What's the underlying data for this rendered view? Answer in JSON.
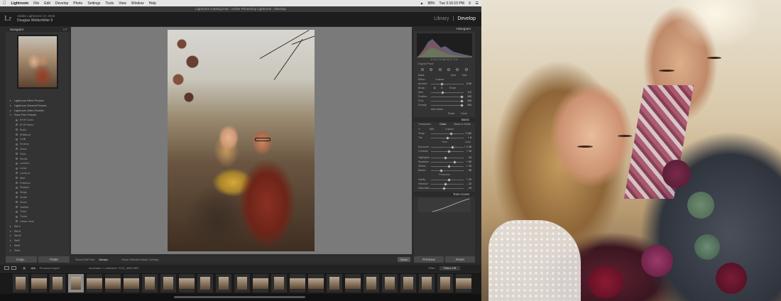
{
  "menubar": {
    "app_name": "Lightroom",
    "items": [
      "File",
      "Edit",
      "Develop",
      "Photo",
      "Settings",
      "Tools",
      "View",
      "Window",
      "Help"
    ],
    "status": [
      "88%",
      "Tue 3:16:10 PM"
    ]
  },
  "window": {
    "title": "Lightroom Catalog.lrcat - Adobe Photoshop Lightroom - Develop"
  },
  "identity": {
    "logo": "Lr",
    "product": "Adobe Lightroom CC 2015",
    "user": "Douglas Wettenhiller II"
  },
  "modules": {
    "library": "Library",
    "separator": "|",
    "develop": "Develop"
  },
  "navigator": {
    "title": "Navigator",
    "zoom": "FIT"
  },
  "presets": [
    {
      "label": "Lightroom Effect Presets",
      "sub": false
    },
    {
      "label": "Lightroom General Presets",
      "sub": false
    },
    {
      "label": "Lightroom Video Presets",
      "sub": false
    },
    {
      "label": "Rose Film Presets",
      "sub": false,
      "open": true
    },
    {
      "label": "B+W Cools",
      "sub": true
    },
    {
      "label": "B+W Warm",
      "sub": true
    },
    {
      "label": "Basic",
      "sub": true
    },
    {
      "label": "Brilliance",
      "sub": true
    },
    {
      "label": "Chilli",
      "sub": true
    },
    {
      "label": "Embers",
      "sub": true
    },
    {
      "label": "Gloss",
      "sub": true
    },
    {
      "label": "Glow",
      "sub": true
    },
    {
      "label": "Kindle",
      "sub": true
    },
    {
      "label": "Lumiere",
      "sub": true
    },
    {
      "label": "Lunar",
      "sub": true
    },
    {
      "label": "Luminox",
      "sub": true
    },
    {
      "label": "Mint",
      "sub": true
    },
    {
      "label": "Polished",
      "sub": true
    },
    {
      "label": "Radiant",
      "sub": true
    },
    {
      "label": "Singe",
      "sub": true
    },
    {
      "label": "Spark",
      "sub": true
    },
    {
      "label": "Storm",
      "sub": true
    },
    {
      "label": "Swelter",
      "sub": true
    },
    {
      "label": "Thaw",
      "sub": true
    },
    {
      "label": "Tinder",
      "sub": true
    },
    {
      "label": "Urban Haze",
      "sub": true
    },
    {
      "label": "Set 1",
      "sub": false
    },
    {
      "label": "Set II",
      "sub": false
    },
    {
      "label": "Set I1",
      "sub": false
    },
    {
      "label": "Set2",
      "sub": false
    },
    {
      "label": "Set3",
      "sub": false
    },
    {
      "label": "Set4",
      "sub": false
    }
  ],
  "left_buttons": {
    "copy": "Copy...",
    "paste": "Paste"
  },
  "toolbar": {
    "show_edit_pins": "Show Edit Pins :",
    "edit_pins_value": "Always",
    "show_mask_overlay": "Show Selected Mask Overlay",
    "done": "Done"
  },
  "histogram": {
    "title": "Histogram",
    "readout": "R 22.4  G 26.0  B 17.9 %",
    "original_photo": "Original Photo"
  },
  "brush": {
    "mask_label": "Mask :",
    "mask_new": "New",
    "mask_edit": "Edit",
    "effect_label": "Effect :",
    "effect_value": "Custom",
    "amount_label": "Amount",
    "amount_value": "0.00",
    "brush_label": "Brush :",
    "brush_a": "A",
    "brush_b": "B",
    "brush_erase": "Erase",
    "rows": [
      {
        "label": "Size",
        "value": "9.0",
        "pos": 0.35
      },
      {
        "label": "Feather",
        "value": "100",
        "pos": 0.95
      },
      {
        "label": "Flow",
        "value": "100",
        "pos": 0.95
      },
      {
        "label": "Density",
        "value": "100",
        "pos": 0.95
      }
    ],
    "automask": "Auto Mask",
    "reset": "Reset",
    "close": "Close"
  },
  "basic": {
    "title": "Basic",
    "treatment_label": "Treatment :",
    "color": "Color",
    "bw": "Black & White",
    "wb_label": "WB :",
    "wb_value": "Custom",
    "temp_tint": [
      {
        "label": "Temp",
        "value": "7,100",
        "pos": 0.62
      },
      {
        "label": "Tint",
        "value": "+ 8",
        "pos": 0.52
      }
    ],
    "tone_label": "Tone",
    "auto": "Auto",
    "tone_rows": [
      {
        "label": "Exposure",
        "value": "+ 1.45",
        "pos": 0.66
      },
      {
        "label": "Contrast",
        "value": "+ 15",
        "pos": 0.56
      }
    ],
    "hl_rows": [
      {
        "label": "Highlights",
        "value": "- 15",
        "pos": 0.44
      },
      {
        "label": "Shadows",
        "value": "+ 50",
        "pos": 0.72
      },
      {
        "label": "Whites",
        "value": "+ 15",
        "pos": 0.56
      },
      {
        "label": "Blacks",
        "value": "- 36",
        "pos": 0.32
      }
    ],
    "presence_label": "Presence",
    "presence_rows": [
      {
        "label": "Clarity",
        "value": "+ 10",
        "pos": 0.55
      },
      {
        "label": "Vibrance",
        "value": "- 12",
        "pos": 0.44
      },
      {
        "label": "Saturation",
        "value": "- 19",
        "pos": 0.41
      }
    ]
  },
  "tone_curve": {
    "title": "Tone Curve"
  },
  "right_buttons": {
    "previous": "Previous",
    "reset": "Reset"
  },
  "filmstrip": {
    "previous_import": "Previous Import",
    "info": "44 photos / 1 selected / TCG_4909.NEF",
    "filter_label": "Filter :",
    "filter_value": "Filters Off",
    "thumbs": [
      {
        "w": 14,
        "h": 18,
        "sel": false
      },
      {
        "w": 22,
        "h": 15,
        "sel": false
      },
      {
        "w": 14,
        "h": 18,
        "sel": false
      },
      {
        "w": 14,
        "h": 18,
        "sel": true
      },
      {
        "w": 22,
        "h": 15,
        "sel": false
      },
      {
        "w": 22,
        "h": 15,
        "sel": false
      },
      {
        "w": 22,
        "h": 15,
        "sel": false
      },
      {
        "w": 14,
        "h": 18,
        "sel": false
      },
      {
        "w": 14,
        "h": 18,
        "sel": false
      },
      {
        "w": 22,
        "h": 15,
        "sel": false
      },
      {
        "w": 14,
        "h": 18,
        "sel": false
      },
      {
        "w": 14,
        "h": 18,
        "sel": false
      },
      {
        "w": 14,
        "h": 18,
        "sel": false
      },
      {
        "w": 22,
        "h": 15,
        "sel": false
      },
      {
        "w": 14,
        "h": 18,
        "sel": false
      },
      {
        "w": 22,
        "h": 15,
        "sel": false
      },
      {
        "w": 22,
        "h": 15,
        "sel": false
      },
      {
        "w": 14,
        "h": 18,
        "sel": false
      },
      {
        "w": 22,
        "h": 15,
        "sel": false
      },
      {
        "w": 14,
        "h": 18,
        "sel": false
      },
      {
        "w": 14,
        "h": 18,
        "sel": false
      },
      {
        "w": 14,
        "h": 18,
        "sel": false
      },
      {
        "w": 14,
        "h": 18,
        "sel": false
      },
      {
        "w": 14,
        "h": 18,
        "sel": false
      },
      {
        "w": 22,
        "h": 15,
        "sel": false
      }
    ]
  }
}
